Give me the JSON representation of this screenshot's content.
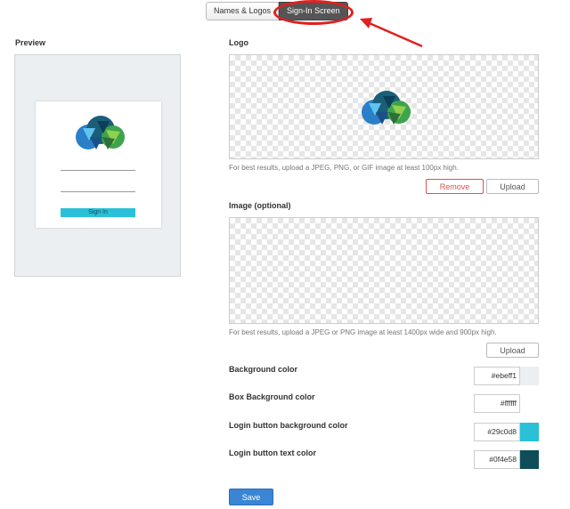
{
  "tabs": [
    {
      "label": "Names & Logos",
      "active": false
    },
    {
      "label": "Sign-In Screen",
      "active": true
    }
  ],
  "preview": {
    "title": "Preview",
    "signin_label": "Sign In"
  },
  "logo": {
    "label": "Logo",
    "hint": "For best results, upload a JPEG, PNG, or GIF image at least 100px high.",
    "remove_label": "Remove",
    "upload_label": "Upload"
  },
  "image": {
    "label": "Image (optional)",
    "hint": "For best results, upload a JPEG or PNG image at least 1400px wide and 900px high.",
    "upload_label": "Upload"
  },
  "colors": [
    {
      "label": "Background color",
      "value": "#ebeff1",
      "swatch": "#ebeff1"
    },
    {
      "label": "Box Background color",
      "value": "#ffffff",
      "swatch": "#ffffff"
    },
    {
      "label": "Login button background color",
      "value": "#29c0d8",
      "swatch": "#29c0d8"
    },
    {
      "label": "Login button text color",
      "value": "#0f4e58",
      "swatch": "#0f4e58"
    }
  ],
  "save_label": "Save",
  "accent_colors": {
    "annotation": "#e02020",
    "save": "#3a86d4"
  },
  "icons": {
    "logo": "cloud-logo-icon",
    "arrow": "annotation-arrow-icon"
  }
}
